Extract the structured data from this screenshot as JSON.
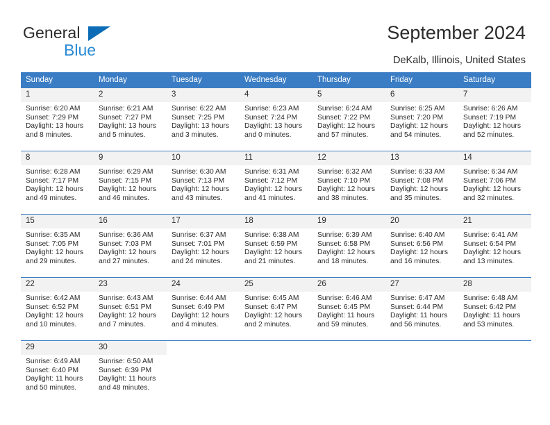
{
  "brand": {
    "line1": "General",
    "line2": "Blue",
    "icon": "triangle-logo-icon",
    "colors": {
      "text": "#2b2b2b",
      "blue": "#2a8ad4",
      "triangle": "#0c6cb5"
    }
  },
  "header": {
    "title": "September 2024",
    "subtitle": "DeKalb, Illinois, United States"
  },
  "theme": {
    "header_bg": "#3b7dc4",
    "header_text": "#ffffff",
    "daynum_bg": "#f2f2f2",
    "grid_line": "#3b7dc4"
  },
  "weekday_headers": [
    "Sunday",
    "Monday",
    "Tuesday",
    "Wednesday",
    "Thursday",
    "Friday",
    "Saturday"
  ],
  "labels": {
    "sunrise": "Sunrise:",
    "sunset": "Sunset:",
    "daylight": "Daylight:"
  },
  "weeks": [
    [
      {
        "day": "1",
        "sunrise": "Sunrise: 6:20 AM",
        "sunset": "Sunset: 7:29 PM",
        "daylight": "Daylight: 13 hours and 8 minutes."
      },
      {
        "day": "2",
        "sunrise": "Sunrise: 6:21 AM",
        "sunset": "Sunset: 7:27 PM",
        "daylight": "Daylight: 13 hours and 5 minutes."
      },
      {
        "day": "3",
        "sunrise": "Sunrise: 6:22 AM",
        "sunset": "Sunset: 7:25 PM",
        "daylight": "Daylight: 13 hours and 3 minutes."
      },
      {
        "day": "4",
        "sunrise": "Sunrise: 6:23 AM",
        "sunset": "Sunset: 7:24 PM",
        "daylight": "Daylight: 13 hours and 0 minutes."
      },
      {
        "day": "5",
        "sunrise": "Sunrise: 6:24 AM",
        "sunset": "Sunset: 7:22 PM",
        "daylight": "Daylight: 12 hours and 57 minutes."
      },
      {
        "day": "6",
        "sunrise": "Sunrise: 6:25 AM",
        "sunset": "Sunset: 7:20 PM",
        "daylight": "Daylight: 12 hours and 54 minutes."
      },
      {
        "day": "7",
        "sunrise": "Sunrise: 6:26 AM",
        "sunset": "Sunset: 7:19 PM",
        "daylight": "Daylight: 12 hours and 52 minutes."
      }
    ],
    [
      {
        "day": "8",
        "sunrise": "Sunrise: 6:28 AM",
        "sunset": "Sunset: 7:17 PM",
        "daylight": "Daylight: 12 hours and 49 minutes."
      },
      {
        "day": "9",
        "sunrise": "Sunrise: 6:29 AM",
        "sunset": "Sunset: 7:15 PM",
        "daylight": "Daylight: 12 hours and 46 minutes."
      },
      {
        "day": "10",
        "sunrise": "Sunrise: 6:30 AM",
        "sunset": "Sunset: 7:13 PM",
        "daylight": "Daylight: 12 hours and 43 minutes."
      },
      {
        "day": "11",
        "sunrise": "Sunrise: 6:31 AM",
        "sunset": "Sunset: 7:12 PM",
        "daylight": "Daylight: 12 hours and 41 minutes."
      },
      {
        "day": "12",
        "sunrise": "Sunrise: 6:32 AM",
        "sunset": "Sunset: 7:10 PM",
        "daylight": "Daylight: 12 hours and 38 minutes."
      },
      {
        "day": "13",
        "sunrise": "Sunrise: 6:33 AM",
        "sunset": "Sunset: 7:08 PM",
        "daylight": "Daylight: 12 hours and 35 minutes."
      },
      {
        "day": "14",
        "sunrise": "Sunrise: 6:34 AM",
        "sunset": "Sunset: 7:06 PM",
        "daylight": "Daylight: 12 hours and 32 minutes."
      }
    ],
    [
      {
        "day": "15",
        "sunrise": "Sunrise: 6:35 AM",
        "sunset": "Sunset: 7:05 PM",
        "daylight": "Daylight: 12 hours and 29 minutes."
      },
      {
        "day": "16",
        "sunrise": "Sunrise: 6:36 AM",
        "sunset": "Sunset: 7:03 PM",
        "daylight": "Daylight: 12 hours and 27 minutes."
      },
      {
        "day": "17",
        "sunrise": "Sunrise: 6:37 AM",
        "sunset": "Sunset: 7:01 PM",
        "daylight": "Daylight: 12 hours and 24 minutes."
      },
      {
        "day": "18",
        "sunrise": "Sunrise: 6:38 AM",
        "sunset": "Sunset: 6:59 PM",
        "daylight": "Daylight: 12 hours and 21 minutes."
      },
      {
        "day": "19",
        "sunrise": "Sunrise: 6:39 AM",
        "sunset": "Sunset: 6:58 PM",
        "daylight": "Daylight: 12 hours and 18 minutes."
      },
      {
        "day": "20",
        "sunrise": "Sunrise: 6:40 AM",
        "sunset": "Sunset: 6:56 PM",
        "daylight": "Daylight: 12 hours and 16 minutes."
      },
      {
        "day": "21",
        "sunrise": "Sunrise: 6:41 AM",
        "sunset": "Sunset: 6:54 PM",
        "daylight": "Daylight: 12 hours and 13 minutes."
      }
    ],
    [
      {
        "day": "22",
        "sunrise": "Sunrise: 6:42 AM",
        "sunset": "Sunset: 6:52 PM",
        "daylight": "Daylight: 12 hours and 10 minutes."
      },
      {
        "day": "23",
        "sunrise": "Sunrise: 6:43 AM",
        "sunset": "Sunset: 6:51 PM",
        "daylight": "Daylight: 12 hours and 7 minutes."
      },
      {
        "day": "24",
        "sunrise": "Sunrise: 6:44 AM",
        "sunset": "Sunset: 6:49 PM",
        "daylight": "Daylight: 12 hours and 4 minutes."
      },
      {
        "day": "25",
        "sunrise": "Sunrise: 6:45 AM",
        "sunset": "Sunset: 6:47 PM",
        "daylight": "Daylight: 12 hours and 2 minutes."
      },
      {
        "day": "26",
        "sunrise": "Sunrise: 6:46 AM",
        "sunset": "Sunset: 6:45 PM",
        "daylight": "Daylight: 11 hours and 59 minutes."
      },
      {
        "day": "27",
        "sunrise": "Sunrise: 6:47 AM",
        "sunset": "Sunset: 6:44 PM",
        "daylight": "Daylight: 11 hours and 56 minutes."
      },
      {
        "day": "28",
        "sunrise": "Sunrise: 6:48 AM",
        "sunset": "Sunset: 6:42 PM",
        "daylight": "Daylight: 11 hours and 53 minutes."
      }
    ],
    [
      {
        "day": "29",
        "sunrise": "Sunrise: 6:49 AM",
        "sunset": "Sunset: 6:40 PM",
        "daylight": "Daylight: 11 hours and 50 minutes."
      },
      {
        "day": "30",
        "sunrise": "Sunrise: 6:50 AM",
        "sunset": "Sunset: 6:39 PM",
        "daylight": "Daylight: 11 hours and 48 minutes."
      },
      {
        "day": "",
        "sunrise": "",
        "sunset": "",
        "daylight": ""
      },
      {
        "day": "",
        "sunrise": "",
        "sunset": "",
        "daylight": ""
      },
      {
        "day": "",
        "sunrise": "",
        "sunset": "",
        "daylight": ""
      },
      {
        "day": "",
        "sunrise": "",
        "sunset": "",
        "daylight": ""
      },
      {
        "day": "",
        "sunrise": "",
        "sunset": "",
        "daylight": ""
      }
    ]
  ]
}
